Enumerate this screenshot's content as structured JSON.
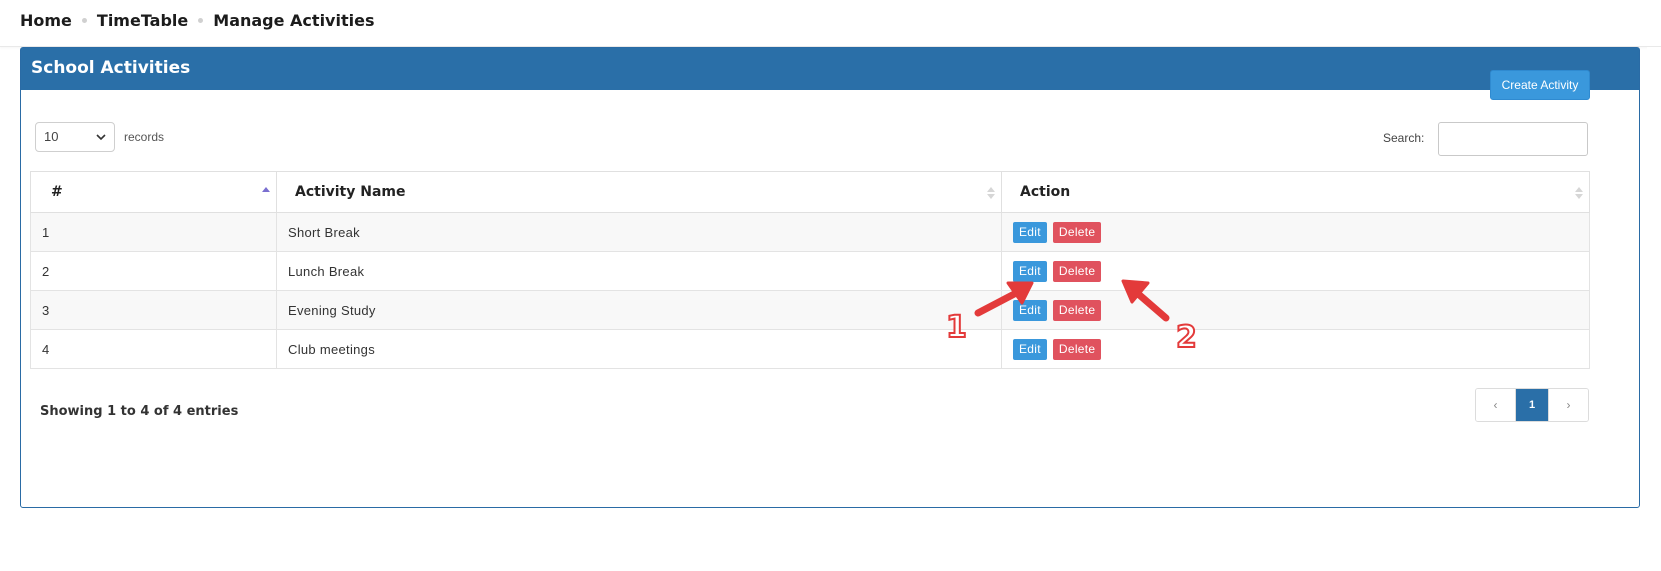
{
  "breadcrumb": {
    "items": [
      "Home",
      "TimeTable",
      "Manage Activities"
    ]
  },
  "panel": {
    "title": "School Activities"
  },
  "toolbar": {
    "create_label": "Create Activity"
  },
  "length": {
    "selected": "10",
    "suffix": "records"
  },
  "search": {
    "label": "Search:",
    "value": "",
    "placeholder": ""
  },
  "table": {
    "headers": [
      "#",
      "Activity Name",
      "Action"
    ],
    "rows": [
      {
        "num": "1",
        "name": "Short Break",
        "edit": "Edit",
        "delete": "Delete"
      },
      {
        "num": "2",
        "name": "Lunch Break",
        "edit": "Edit",
        "delete": "Delete"
      },
      {
        "num": "3",
        "name": "Evening Study",
        "edit": "Edit",
        "delete": "Delete"
      },
      {
        "num": "4",
        "name": "Club meetings",
        "edit": "Edit",
        "delete": "Delete"
      }
    ]
  },
  "footer": {
    "info": "Showing 1 to 4 of 4 entries",
    "pagination": {
      "prev": "‹",
      "current": "1",
      "next": "›"
    }
  },
  "annotations": {
    "label_1": "1",
    "label_2": "2",
    "arrow_color": "#e33a3a"
  },
  "colors": {
    "header_blue": "#2a6fa8",
    "edit_blue": "#3a98dc",
    "delete_red": "#e0525e"
  }
}
